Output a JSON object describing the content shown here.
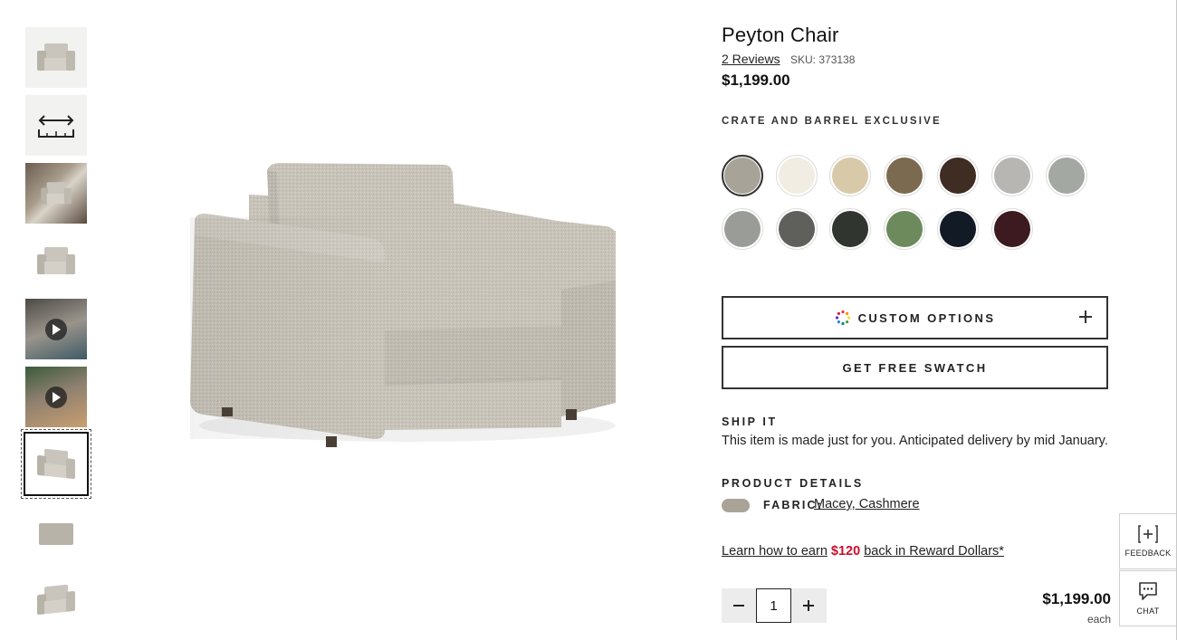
{
  "gallery": {
    "thumbnails": [
      {
        "kind": "chair",
        "label": "front view"
      },
      {
        "kind": "dimensions",
        "label": "dimensions"
      },
      {
        "kind": "scene",
        "label": "room scene"
      },
      {
        "kind": "chair",
        "label": "front view white"
      },
      {
        "kind": "video",
        "label": "video 1"
      },
      {
        "kind": "video",
        "label": "video 2"
      },
      {
        "kind": "chair",
        "label": "angle view",
        "selected": true
      },
      {
        "kind": "chair",
        "label": "side view"
      },
      {
        "kind": "chair",
        "label": "back angle view"
      }
    ]
  },
  "product": {
    "title": "Peyton Chair",
    "reviews": "2 Reviews",
    "sku": "SKU: 373138",
    "price": "$1,199.00",
    "exclusive": "CRATE AND BARREL EXCLUSIVE",
    "swatches": [
      {
        "color": "#a8a398",
        "selected": true
      },
      {
        "color": "#f1ede2"
      },
      {
        "color": "#d8c9a8"
      },
      {
        "color": "#7b6a50"
      },
      {
        "color": "#3f2c22"
      },
      {
        "color": "#b7b6b3"
      },
      {
        "color": "#a4a8a3"
      },
      {
        "color": "#9a9d97"
      },
      {
        "color": "#5f605c"
      },
      {
        "color": "#30352f"
      },
      {
        "color": "#6c8a5c"
      },
      {
        "color": "#121a26"
      },
      {
        "color": "#3d1a1f"
      }
    ],
    "custom_options_label": "CUSTOM OPTIONS",
    "free_swatch_label": "GET FREE SWATCH",
    "ship_label": "SHIP IT",
    "ship_text": "This item is made just for you. Anticipated delivery by mid January.",
    "details_label": "PRODUCT DETAILS",
    "fabric_label": "FABRIC:",
    "fabric_value": "Macey, Cashmere",
    "fabric_chip_color": "#a9a296",
    "reward": {
      "prefix": "Learn how to earn",
      "amount": "$120",
      "suffix": "back in Reward Dollars*"
    },
    "quantity": "1",
    "line_price": "$1,199.00",
    "line_each": "each"
  },
  "side_widgets": {
    "feedback": "FEEDBACK",
    "chat": "CHAT"
  },
  "colors": {
    "accent_red": "#c8102e",
    "fabric": "#c9c5bc"
  }
}
